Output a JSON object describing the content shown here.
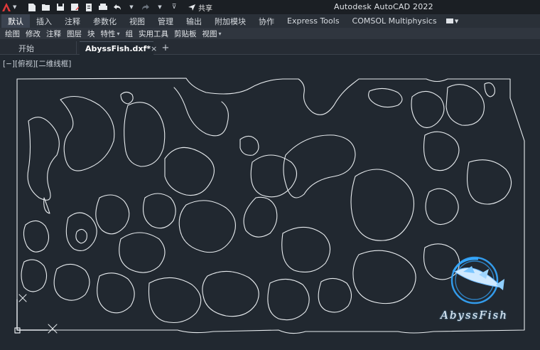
{
  "title_bar": {
    "app_title": "Autodesk AutoCAD 2022",
    "share_label": "共享",
    "logo_icon": "autocad-a-icon",
    "quick_access": [
      "new-icon",
      "open-icon",
      "save-icon",
      "saveas-icon",
      "print-icon",
      "plot-icon",
      "undo-icon",
      "redo-icon",
      "dropdown-icon"
    ]
  },
  "ribbon_tabs": [
    {
      "label": "默认",
      "active": true
    },
    {
      "label": "插入"
    },
    {
      "label": "注释"
    },
    {
      "label": "参数化"
    },
    {
      "label": "视图"
    },
    {
      "label": "管理"
    },
    {
      "label": "输出"
    },
    {
      "label": "附加模块"
    },
    {
      "label": "协作"
    },
    {
      "label": "Express Tools"
    },
    {
      "label": "COMSOL Multiphysics"
    }
  ],
  "ribbon_panels": [
    {
      "label": "绘图"
    },
    {
      "label": "修改"
    },
    {
      "label": "注释"
    },
    {
      "label": "图层"
    },
    {
      "label": "块"
    },
    {
      "label": "特性",
      "caret": "▾"
    },
    {
      "label": "组"
    },
    {
      "label": "实用工具"
    },
    {
      "label": "剪贴板"
    },
    {
      "label": "视图",
      "caret": "▾"
    }
  ],
  "file_tabs": {
    "start_label": "开始",
    "file_label": "AbyssFish.dxf*",
    "close_glyph": "×",
    "add_glyph": "+"
  },
  "viewport": {
    "controls_label": "[−][俯视][二维线框]"
  },
  "watermark": {
    "text": "AbyssFish"
  },
  "colors": {
    "canvas": "#212830",
    "stroke": "#e8ecef",
    "accent_red": "#e23a3a",
    "watermark_blue": "#35a7ff"
  }
}
